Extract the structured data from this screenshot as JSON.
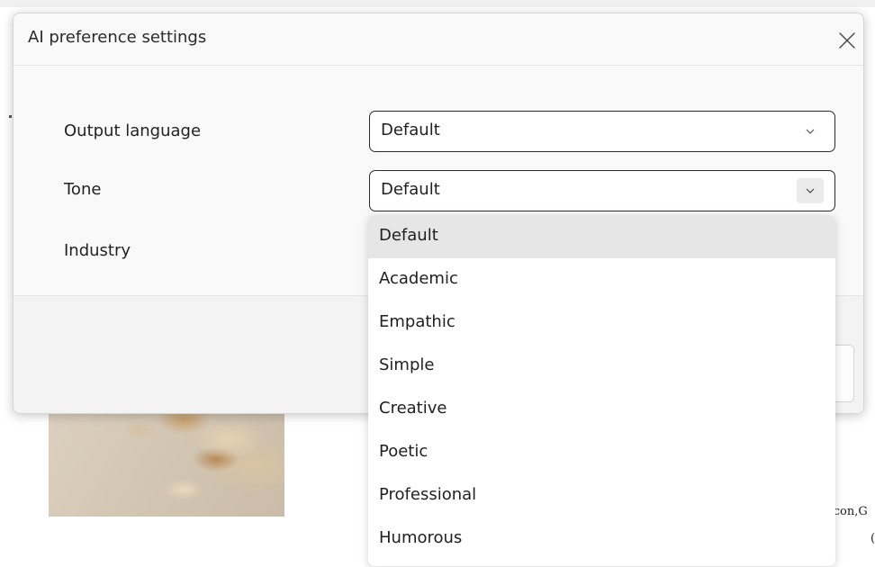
{
  "dialog": {
    "title": "AI preference settings",
    "close_icon": "close-icon"
  },
  "fields": {
    "output_language": {
      "label": "Output language",
      "value": "Default"
    },
    "tone": {
      "label": "Tone",
      "value": "Default"
    },
    "industry": {
      "label": "Industry"
    }
  },
  "tone_options": [
    "Default",
    "Academic",
    "Empathic",
    "Simple",
    "Creative",
    "Poetic",
    "Professional",
    "Humorous"
  ],
  "tone_selected": "Default",
  "background": {
    "partial_text_1": "acon,G",
    "partial_text_2": "("
  },
  "icons": {
    "dropdown": "chevron-down-icon",
    "close": "close-icon"
  },
  "colors": {
    "dialog_bg": "#f9f9f9",
    "field_border": "#2b2b2b",
    "selected_option_bg": "#e6e6e6"
  }
}
